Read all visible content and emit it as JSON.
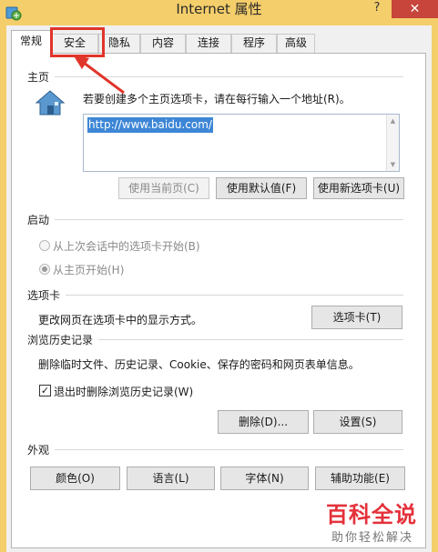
{
  "window": {
    "title": "Internet 属性",
    "help": "?",
    "close": "✕"
  },
  "tabs": [
    "常规",
    "安全",
    "隐私",
    "内容",
    "连接",
    "程序",
    "高级"
  ],
  "home": {
    "section": "主页",
    "instruction": "若要创建多个主页选项卡，请在每行输入一个地址(R)。",
    "url": "http://www.baidu.com/",
    "buttons": {
      "use_current": "使用当前页(C)",
      "use_default": "使用默认值(F)",
      "use_new_tab": "使用新选项卡(U)"
    }
  },
  "startup": {
    "section": "启动",
    "option_last_session": "从上次会话中的选项卡开始(B)",
    "option_home": "从主页开始(H)",
    "selected": "option_home"
  },
  "tabs_section": {
    "section": "选项卡",
    "description": "更改网页在选项卡中的显示方式。",
    "button": "选项卡(T)"
  },
  "history": {
    "section": "浏览历史记录",
    "description": "删除临时文件、历史记录、Cookie、保存的密码和网页表单信息。",
    "checkbox_label": "退出时删除浏览历史记录(W)",
    "checkbox_checked": true,
    "delete_button": "删除(D)...",
    "settings_button": "设置(S)"
  },
  "appearance": {
    "section": "外观",
    "colors_button": "颜色(O)",
    "languages_button": "语言(L)",
    "fonts_button": "字体(N)",
    "accessibility_button": "辅助功能(E)"
  },
  "watermark": {
    "main": "百科全说",
    "sub": "助你轻松解决"
  },
  "colors": {
    "title_bar": "#f4ce6a",
    "close_button": "#c7453b",
    "highlight": "#e0352b",
    "selection": "#3d86d6"
  }
}
